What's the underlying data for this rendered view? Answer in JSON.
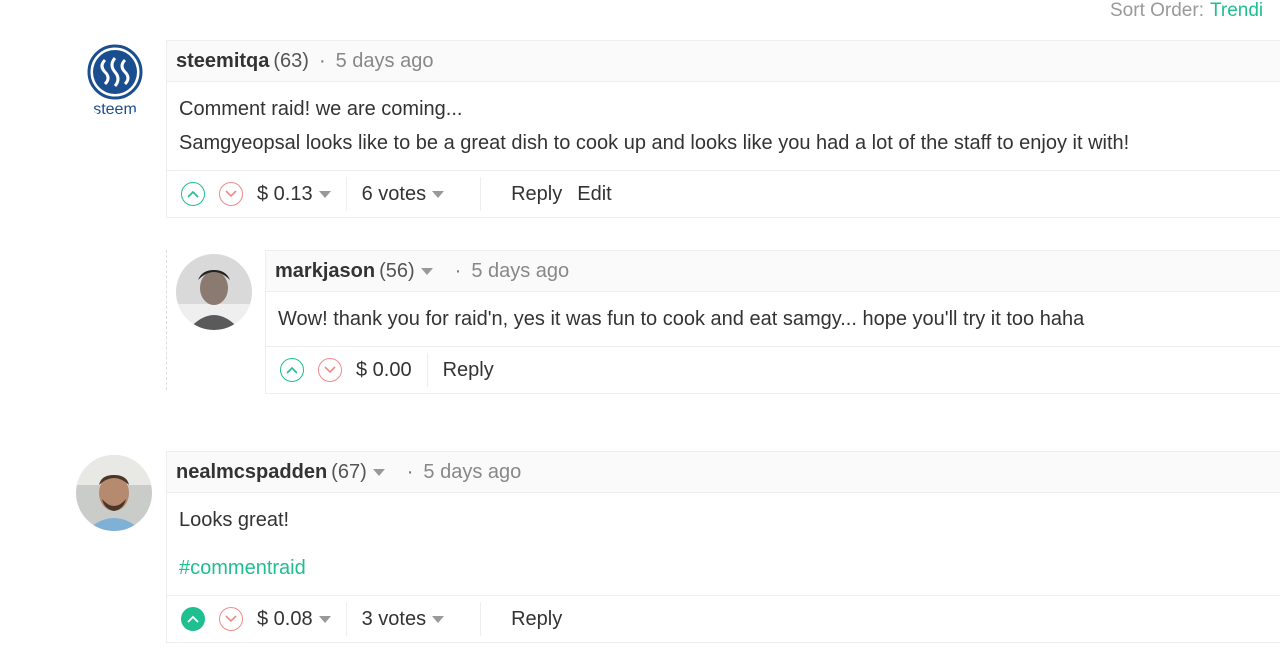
{
  "sort": {
    "label": "Sort Order:",
    "value": "Trendi"
  },
  "comments": [
    {
      "author": "steemitqa",
      "reputation": "(63)",
      "separator": "·",
      "time": "5 days ago",
      "avatar_text": "steem",
      "lines": [
        "Comment raid! we are coming...",
        "Samgyeopsal looks like to be a great dish to cook up and looks like you had a lot of the staff to enjoy it with!"
      ],
      "payout": "$ 0.13",
      "votes": "6 votes",
      "reply_label": "Reply",
      "edit_label": "Edit"
    },
    {
      "author": "markjason",
      "reputation": "(56)",
      "separator": "·",
      "time": "5 days ago",
      "lines": [
        "Wow! thank you for raid'n, yes it was fun to cook and eat samgy... hope you'll try it too haha"
      ],
      "payout": "$ 0.00",
      "reply_label": "Reply"
    },
    {
      "author": "nealmcspadden",
      "reputation": "(67)",
      "separator": "·",
      "time": "5 days ago",
      "lines": [
        "Looks great!"
      ],
      "tag": "#commentraid",
      "payout": "$ 0.08",
      "votes": "3 votes",
      "reply_label": "Reply"
    }
  ],
  "colors": {
    "accent": "#1fbf8f",
    "downvote": "#f08a8a",
    "steem_blue": "#1a4e8f"
  }
}
